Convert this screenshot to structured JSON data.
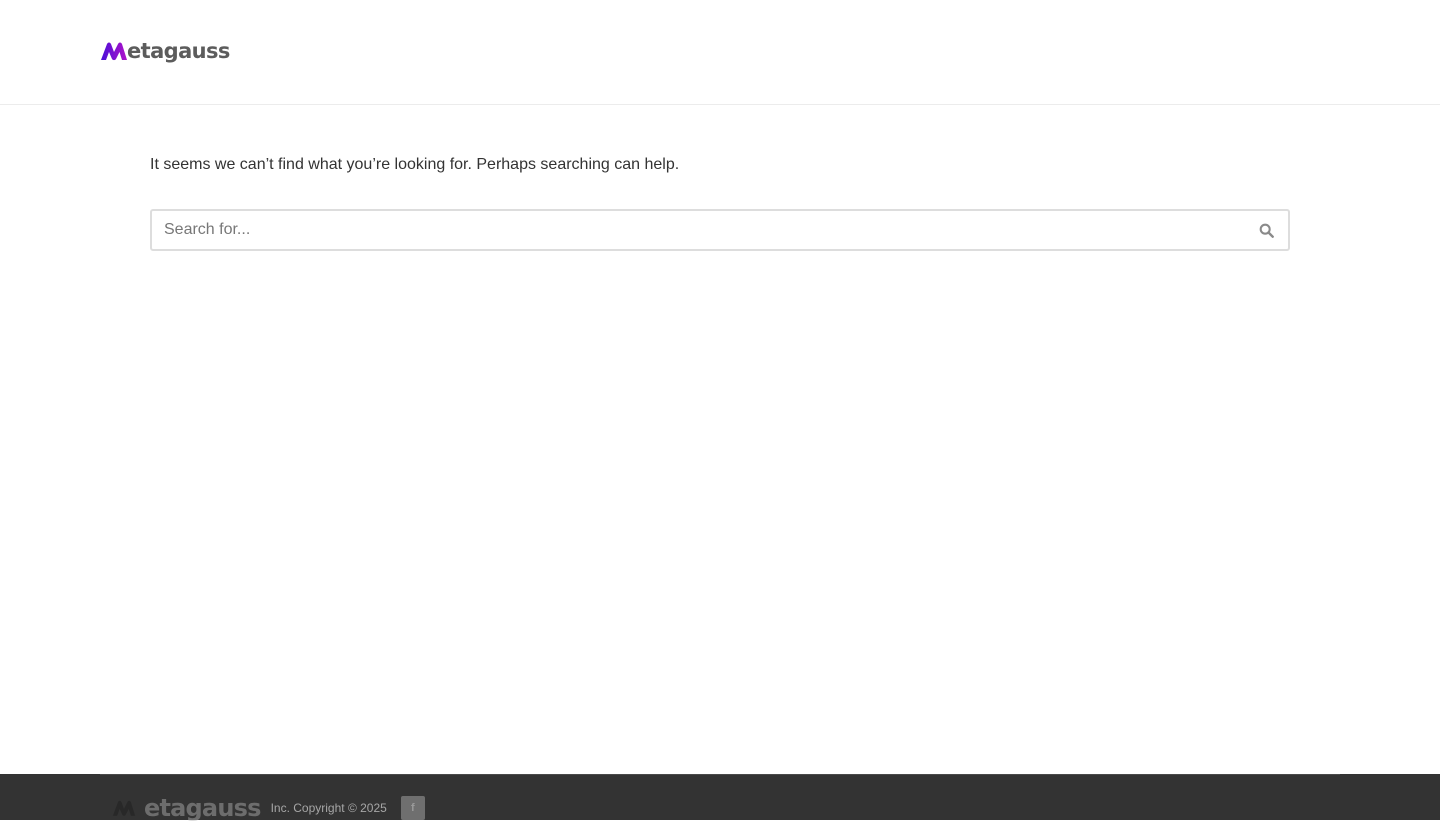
{
  "header": {
    "logo_text": "etagauss",
    "logo_mark_icon": "metagauss-m-logo-icon",
    "brand_colors": {
      "mark_start": "#4a0fd8",
      "mark_end": "#b012c9",
      "text": "#5c5c5c"
    }
  },
  "main": {
    "not_found_message": "It seems we can’t find what you’re looking for. Perhaps searching can help.",
    "search": {
      "placeholder": "Search for...",
      "value": "",
      "submit_icon": "search-icon"
    }
  },
  "footer": {
    "logo_text": "etagauss",
    "copyright": "Inc. Copyright © 2025",
    "social": [
      {
        "label": "f",
        "icon": "facebook-icon"
      }
    ],
    "background": "#333333"
  }
}
